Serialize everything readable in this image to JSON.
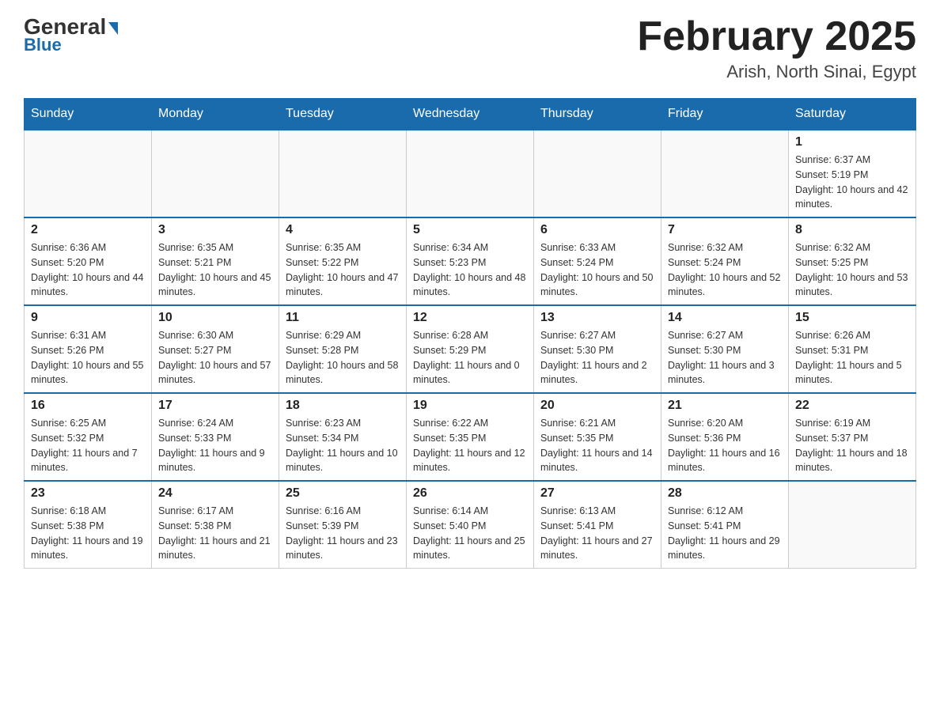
{
  "header": {
    "logo_general": "General",
    "logo_blue": "Blue",
    "month_title": "February 2025",
    "location": "Arish, North Sinai, Egypt"
  },
  "days_of_week": [
    "Sunday",
    "Monday",
    "Tuesday",
    "Wednesday",
    "Thursday",
    "Friday",
    "Saturday"
  ],
  "weeks": [
    [
      {
        "day": "",
        "sunrise": "",
        "sunset": "",
        "daylight": "",
        "empty": true
      },
      {
        "day": "",
        "sunrise": "",
        "sunset": "",
        "daylight": "",
        "empty": true
      },
      {
        "day": "",
        "sunrise": "",
        "sunset": "",
        "daylight": "",
        "empty": true
      },
      {
        "day": "",
        "sunrise": "",
        "sunset": "",
        "daylight": "",
        "empty": true
      },
      {
        "day": "",
        "sunrise": "",
        "sunset": "",
        "daylight": "",
        "empty": true
      },
      {
        "day": "",
        "sunrise": "",
        "sunset": "",
        "daylight": "",
        "empty": true
      },
      {
        "day": "1",
        "sunrise": "Sunrise: 6:37 AM",
        "sunset": "Sunset: 5:19 PM",
        "daylight": "Daylight: 10 hours and 42 minutes.",
        "empty": false
      }
    ],
    [
      {
        "day": "2",
        "sunrise": "Sunrise: 6:36 AM",
        "sunset": "Sunset: 5:20 PM",
        "daylight": "Daylight: 10 hours and 44 minutes.",
        "empty": false
      },
      {
        "day": "3",
        "sunrise": "Sunrise: 6:35 AM",
        "sunset": "Sunset: 5:21 PM",
        "daylight": "Daylight: 10 hours and 45 minutes.",
        "empty": false
      },
      {
        "day": "4",
        "sunrise": "Sunrise: 6:35 AM",
        "sunset": "Sunset: 5:22 PM",
        "daylight": "Daylight: 10 hours and 47 minutes.",
        "empty": false
      },
      {
        "day": "5",
        "sunrise": "Sunrise: 6:34 AM",
        "sunset": "Sunset: 5:23 PM",
        "daylight": "Daylight: 10 hours and 48 minutes.",
        "empty": false
      },
      {
        "day": "6",
        "sunrise": "Sunrise: 6:33 AM",
        "sunset": "Sunset: 5:24 PM",
        "daylight": "Daylight: 10 hours and 50 minutes.",
        "empty": false
      },
      {
        "day": "7",
        "sunrise": "Sunrise: 6:32 AM",
        "sunset": "Sunset: 5:24 PM",
        "daylight": "Daylight: 10 hours and 52 minutes.",
        "empty": false
      },
      {
        "day": "8",
        "sunrise": "Sunrise: 6:32 AM",
        "sunset": "Sunset: 5:25 PM",
        "daylight": "Daylight: 10 hours and 53 minutes.",
        "empty": false
      }
    ],
    [
      {
        "day": "9",
        "sunrise": "Sunrise: 6:31 AM",
        "sunset": "Sunset: 5:26 PM",
        "daylight": "Daylight: 10 hours and 55 minutes.",
        "empty": false
      },
      {
        "day": "10",
        "sunrise": "Sunrise: 6:30 AM",
        "sunset": "Sunset: 5:27 PM",
        "daylight": "Daylight: 10 hours and 57 minutes.",
        "empty": false
      },
      {
        "day": "11",
        "sunrise": "Sunrise: 6:29 AM",
        "sunset": "Sunset: 5:28 PM",
        "daylight": "Daylight: 10 hours and 58 minutes.",
        "empty": false
      },
      {
        "day": "12",
        "sunrise": "Sunrise: 6:28 AM",
        "sunset": "Sunset: 5:29 PM",
        "daylight": "Daylight: 11 hours and 0 minutes.",
        "empty": false
      },
      {
        "day": "13",
        "sunrise": "Sunrise: 6:27 AM",
        "sunset": "Sunset: 5:30 PM",
        "daylight": "Daylight: 11 hours and 2 minutes.",
        "empty": false
      },
      {
        "day": "14",
        "sunrise": "Sunrise: 6:27 AM",
        "sunset": "Sunset: 5:30 PM",
        "daylight": "Daylight: 11 hours and 3 minutes.",
        "empty": false
      },
      {
        "day": "15",
        "sunrise": "Sunrise: 6:26 AM",
        "sunset": "Sunset: 5:31 PM",
        "daylight": "Daylight: 11 hours and 5 minutes.",
        "empty": false
      }
    ],
    [
      {
        "day": "16",
        "sunrise": "Sunrise: 6:25 AM",
        "sunset": "Sunset: 5:32 PM",
        "daylight": "Daylight: 11 hours and 7 minutes.",
        "empty": false
      },
      {
        "day": "17",
        "sunrise": "Sunrise: 6:24 AM",
        "sunset": "Sunset: 5:33 PM",
        "daylight": "Daylight: 11 hours and 9 minutes.",
        "empty": false
      },
      {
        "day": "18",
        "sunrise": "Sunrise: 6:23 AM",
        "sunset": "Sunset: 5:34 PM",
        "daylight": "Daylight: 11 hours and 10 minutes.",
        "empty": false
      },
      {
        "day": "19",
        "sunrise": "Sunrise: 6:22 AM",
        "sunset": "Sunset: 5:35 PM",
        "daylight": "Daylight: 11 hours and 12 minutes.",
        "empty": false
      },
      {
        "day": "20",
        "sunrise": "Sunrise: 6:21 AM",
        "sunset": "Sunset: 5:35 PM",
        "daylight": "Daylight: 11 hours and 14 minutes.",
        "empty": false
      },
      {
        "day": "21",
        "sunrise": "Sunrise: 6:20 AM",
        "sunset": "Sunset: 5:36 PM",
        "daylight": "Daylight: 11 hours and 16 minutes.",
        "empty": false
      },
      {
        "day": "22",
        "sunrise": "Sunrise: 6:19 AM",
        "sunset": "Sunset: 5:37 PM",
        "daylight": "Daylight: 11 hours and 18 minutes.",
        "empty": false
      }
    ],
    [
      {
        "day": "23",
        "sunrise": "Sunrise: 6:18 AM",
        "sunset": "Sunset: 5:38 PM",
        "daylight": "Daylight: 11 hours and 19 minutes.",
        "empty": false
      },
      {
        "day": "24",
        "sunrise": "Sunrise: 6:17 AM",
        "sunset": "Sunset: 5:38 PM",
        "daylight": "Daylight: 11 hours and 21 minutes.",
        "empty": false
      },
      {
        "day": "25",
        "sunrise": "Sunrise: 6:16 AM",
        "sunset": "Sunset: 5:39 PM",
        "daylight": "Daylight: 11 hours and 23 minutes.",
        "empty": false
      },
      {
        "day": "26",
        "sunrise": "Sunrise: 6:14 AM",
        "sunset": "Sunset: 5:40 PM",
        "daylight": "Daylight: 11 hours and 25 minutes.",
        "empty": false
      },
      {
        "day": "27",
        "sunrise": "Sunrise: 6:13 AM",
        "sunset": "Sunset: 5:41 PM",
        "daylight": "Daylight: 11 hours and 27 minutes.",
        "empty": false
      },
      {
        "day": "28",
        "sunrise": "Sunrise: 6:12 AM",
        "sunset": "Sunset: 5:41 PM",
        "daylight": "Daylight: 11 hours and 29 minutes.",
        "empty": false
      },
      {
        "day": "",
        "sunrise": "",
        "sunset": "",
        "daylight": "",
        "empty": true
      }
    ]
  ]
}
